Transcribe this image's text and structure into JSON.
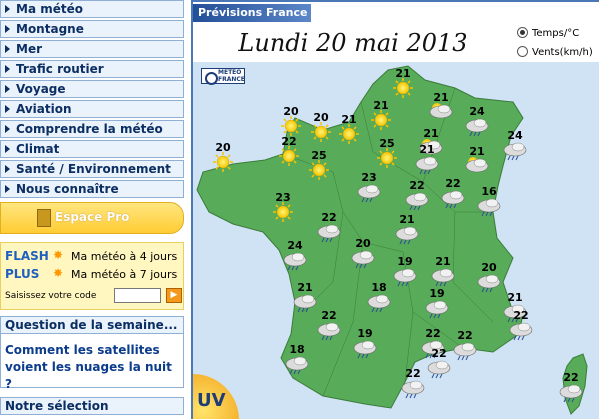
{
  "nav": [
    "Ma météo",
    "Montagne",
    "Mer",
    "Trafic routier",
    "Voyage",
    "Aviation",
    "Comprendre la météo",
    "Climat",
    "Santé / Environnement",
    "Nous connaître"
  ],
  "espace_pro": "Espace Pro",
  "flash_plus": {
    "flash": "FLASH",
    "plus": "PLUS",
    "flash_text": "Ma météo à 4 jours",
    "plus_text": "Ma météo à 7 jours",
    "code_label": "Saisissez votre code",
    "code_value": "",
    "go": "▶"
  },
  "question": {
    "heading": "Question de la semaine...",
    "text": "Comment les satellites voient les nuages la nuit ?"
  },
  "selection_heading": "Notre sélection",
  "panel": {
    "tab": "Prévisions France",
    "date": "Lundi 20 mai 2013",
    "radio_temp": "Temps/°C",
    "radio_wind": "Vents(km/h)",
    "logo": "MÉTÉO FRANCE",
    "uv": "UV"
  },
  "colors": {
    "map_land": "#58ab58",
    "map_sea": "#cfe3f4",
    "border": "#4c77b6"
  },
  "forecasts": [
    {
      "id": "lille",
      "t": "21",
      "icon": "sun"
    },
    {
      "id": "amiens",
      "t": "21",
      "icon": "cloud-sun"
    },
    {
      "id": "rouen",
      "t": "21",
      "icon": "sun"
    },
    {
      "id": "cherbourg",
      "t": "20",
      "icon": "sun"
    },
    {
      "id": "caen",
      "t": "20",
      "icon": "sun"
    },
    {
      "id": "paris-w",
      "t": "21",
      "icon": "sun"
    },
    {
      "id": "metz",
      "t": "24",
      "icon": "cloud-rain"
    },
    {
      "id": "reims",
      "t": "21",
      "icon": "cloud-sun"
    },
    {
      "id": "strasbourg",
      "t": "24",
      "icon": "cloud-rain"
    },
    {
      "id": "brest",
      "t": "20",
      "icon": "sun"
    },
    {
      "id": "rennes",
      "t": "22",
      "icon": "sun"
    },
    {
      "id": "le-mans",
      "t": "25",
      "icon": "sun"
    },
    {
      "id": "orleans",
      "t": "25",
      "icon": "sun"
    },
    {
      "id": "troyes",
      "t": "21",
      "icon": "cloud-sun"
    },
    {
      "id": "nancy",
      "t": "21",
      "icon": "cloud-rain"
    },
    {
      "id": "tours",
      "t": "23",
      "icon": "cloud-rain"
    },
    {
      "id": "dijon",
      "t": "22",
      "icon": "cloud-rain"
    },
    {
      "id": "besancon",
      "t": "22",
      "icon": "cloud-rain"
    },
    {
      "id": "mulhouse",
      "t": "16",
      "icon": "cloud-rain"
    },
    {
      "id": "nantes",
      "t": "23",
      "icon": "sun"
    },
    {
      "id": "poitiers",
      "t": "22",
      "icon": "cloud-rain"
    },
    {
      "id": "bourges",
      "t": "21",
      "icon": "cloud-rain"
    },
    {
      "id": "la-rochelle",
      "t": "24",
      "icon": "cloud-rain"
    },
    {
      "id": "limoges",
      "t": "20",
      "icon": "cloud-rain"
    },
    {
      "id": "clermont",
      "t": "19",
      "icon": "cloud-rain"
    },
    {
      "id": "lyon",
      "t": "21",
      "icon": "cloud-rain"
    },
    {
      "id": "grenoble",
      "t": "20",
      "icon": "cloud-rain"
    },
    {
      "id": "bordeaux",
      "t": "21",
      "icon": "cloud-rain"
    },
    {
      "id": "brive",
      "t": "18",
      "icon": "cloud-rain"
    },
    {
      "id": "le-puy",
      "t": "19",
      "icon": "cloud-rain"
    },
    {
      "id": "gap",
      "t": "21",
      "icon": "cloud-rain"
    },
    {
      "id": "agen",
      "t": "22",
      "icon": "cloud-rain"
    },
    {
      "id": "toulouse",
      "t": "19",
      "icon": "cloud-rain"
    },
    {
      "id": "montpellier",
      "t": "22",
      "icon": "cloud-rain"
    },
    {
      "id": "marseille",
      "t": "22",
      "icon": "cloud-rain"
    },
    {
      "id": "nice",
      "t": "22",
      "icon": "cloud-rain"
    },
    {
      "id": "biarritz",
      "t": "18",
      "icon": "cloud-rain"
    },
    {
      "id": "perpignan",
      "t": "22",
      "icon": "cloud-rain"
    },
    {
      "id": "ajaccio",
      "t": "22",
      "icon": "cloud-rain"
    },
    {
      "id": "lourdes",
      "t": "22",
      "icon": "cloud-rain"
    }
  ]
}
